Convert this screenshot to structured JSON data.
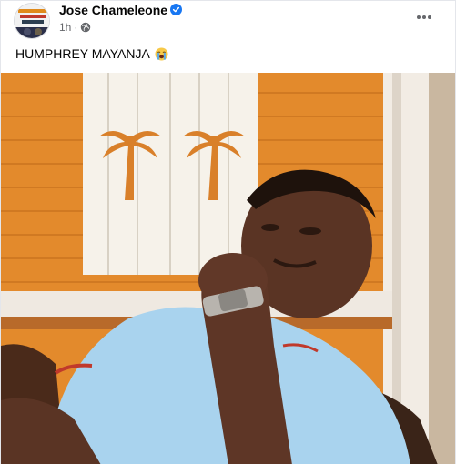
{
  "post": {
    "author": "Jose Chameleone",
    "time": "1h",
    "separator": "·",
    "caption": "HUMPHREY MAYANJA",
    "caption_emoji": "loudly-crying-face",
    "privacy_icon": "globe-icon",
    "more_icon": "more-horizontal-icon",
    "verified_icon": "verified-badge-icon"
  },
  "colors": {
    "verified": "#1877f2",
    "meta_text": "#65676b",
    "wall_orange": "#e38a2c",
    "shirt_blue": "#a9d3ee"
  }
}
